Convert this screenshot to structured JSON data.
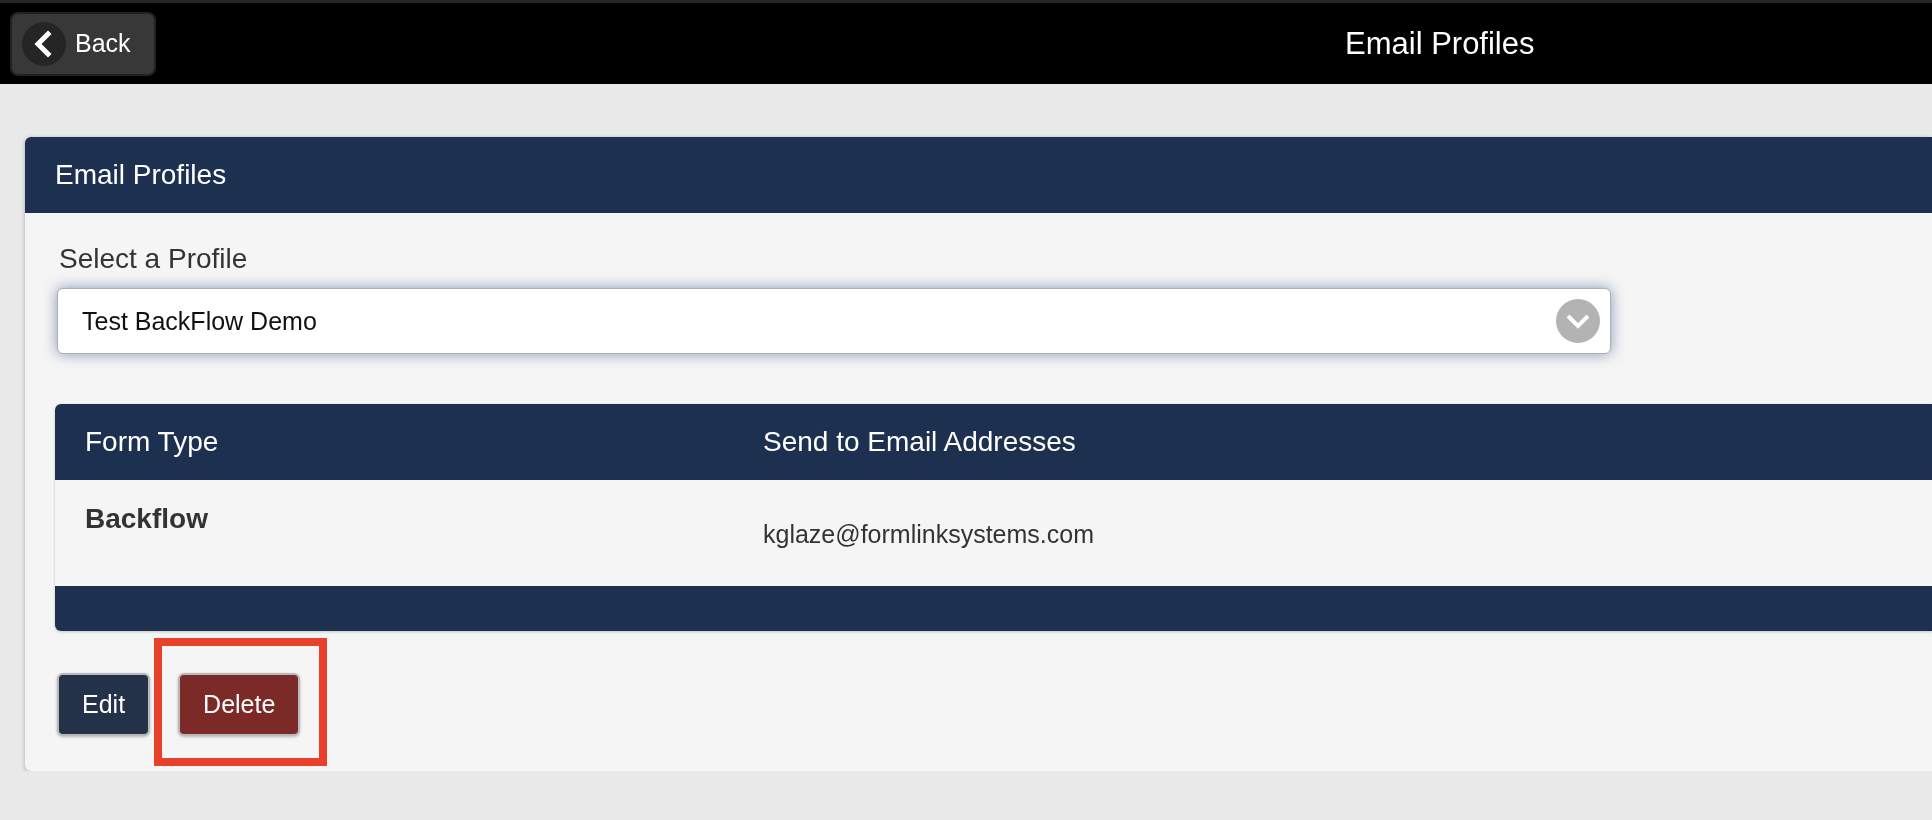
{
  "top_bar": {
    "back_button": {
      "label": "Back"
    },
    "title": "Email Profiles"
  },
  "panel": {
    "title": "Email Profiles",
    "profile_select": {
      "label": "Select a Profile",
      "value": "Test BackFlow Demo"
    },
    "table": {
      "columns": [
        "Form Type",
        "Send to Email Addresses"
      ],
      "rows": [
        {
          "form_type": "Backflow",
          "emails": "kglaze@formlinksystems.com"
        }
      ]
    },
    "buttons": [
      {
        "label": "Edit",
        "kind": "primary",
        "highlighted": false
      },
      {
        "label": "Delete",
        "kind": "danger",
        "highlighted": true
      }
    ]
  }
}
